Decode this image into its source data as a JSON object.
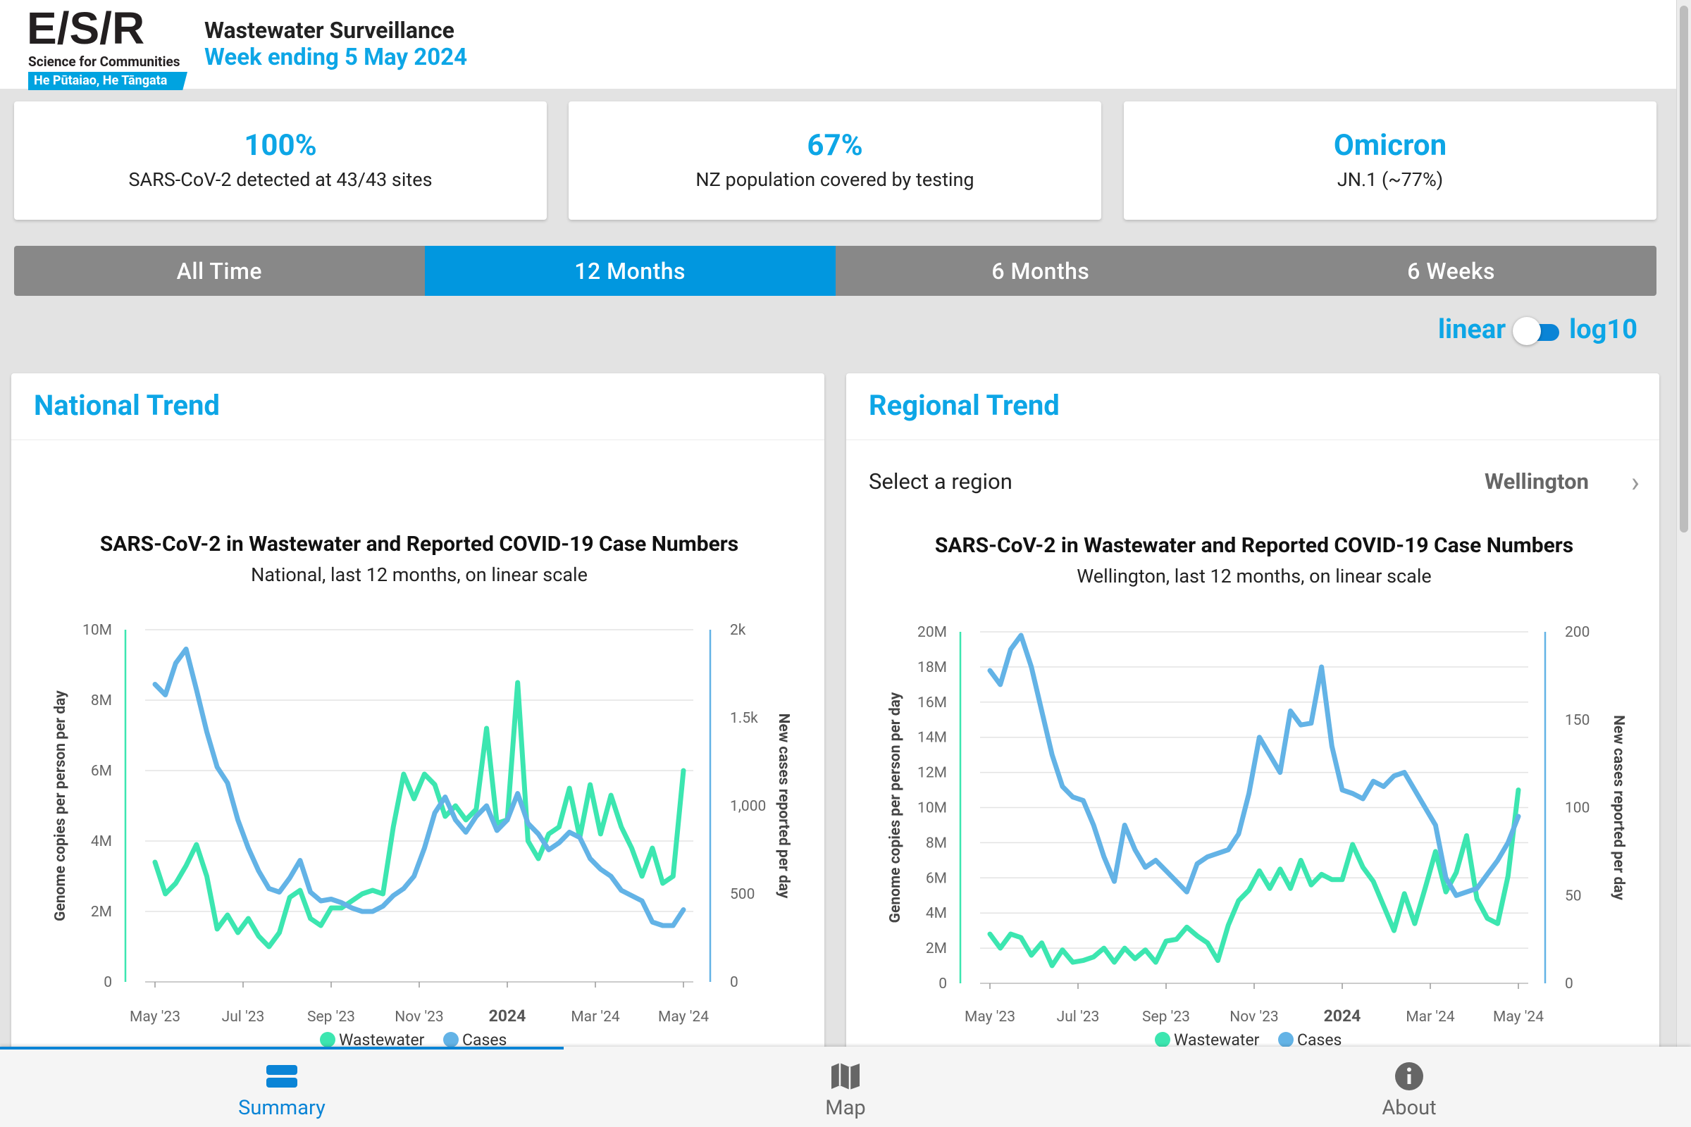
{
  "brand": {
    "logo_text": "E/S/R",
    "tagline": "Science for Communities",
    "tagline_maori": "He Pūtaiao, He Tāngata"
  },
  "header": {
    "title": "Wastewater Surveillance",
    "week": "Week ending 5 May 2024"
  },
  "kpis": [
    {
      "value": "100%",
      "label": "SARS-CoV-2 detected at 43/43 sites"
    },
    {
      "value": "67%",
      "label": "NZ population covered by testing"
    },
    {
      "value": "Omicron",
      "label": "JN.1 (~77%)"
    }
  ],
  "range_tabs": [
    {
      "label": "All Time",
      "active": false
    },
    {
      "label": "12 Months",
      "active": true
    },
    {
      "label": "6 Months",
      "active": false
    },
    {
      "label": "6 Weeks",
      "active": false
    }
  ],
  "scale_toggle": {
    "left": "linear",
    "right": "log10",
    "selected": "linear"
  },
  "national": {
    "card_title": "National Trend"
  },
  "regional": {
    "card_title": "Regional Trend",
    "select_label": "Select a region",
    "selected_region": "Wellington"
  },
  "bottom_nav": [
    {
      "label": "Summary",
      "icon": "summary-icon",
      "active": true
    },
    {
      "label": "Map",
      "icon": "map-icon",
      "active": false
    },
    {
      "label": "About",
      "icon": "info-icon",
      "active": false
    }
  ],
  "colors": {
    "wastewater": "#3ce6b0",
    "cases": "#63b3e6",
    "accent": "#0da6e6",
    "tab_active": "#0197df"
  },
  "chart_data": [
    {
      "type": "line",
      "title": "SARS-CoV-2 in Wastewater and Reported COVID-19 Case Numbers",
      "subtitle": "National, last 12 months, on linear scale",
      "ylabel": "Genome copies per person per day",
      "y2label": "New cases reported per day",
      "xticks": [
        "May '23",
        "Jul '23",
        "Sep '23",
        "Nov '23",
        "2024",
        "Mar '24",
        "May '24"
      ],
      "yticks": [
        "0",
        "2M",
        "4M",
        "6M",
        "8M",
        "10M"
      ],
      "y2ticks": [
        "0",
        "500",
        "1,000",
        "1.5k",
        "2k"
      ],
      "ylim": [
        0,
        10000000
      ],
      "y2lim": [
        0,
        2000
      ],
      "x_weeks": 52,
      "series": [
        {
          "name": "Wastewater",
          "axis": "left",
          "color": "#3ce6b0",
          "values": [
            3.4,
            2.5,
            2.8,
            3.3,
            3.9,
            3.0,
            1.5,
            1.9,
            1.4,
            1.8,
            1.3,
            1.0,
            1.4,
            2.4,
            2.6,
            1.8,
            1.6,
            2.1,
            2.1,
            2.3,
            2.5,
            2.6,
            2.5,
            4.4,
            5.9,
            5.2,
            5.9,
            5.6,
            4.7,
            5.0,
            4.6,
            4.9,
            7.2,
            4.5,
            4.6,
            8.5,
            4.0,
            3.5,
            4.2,
            4.4,
            5.5,
            4.1,
            5.6,
            4.2,
            5.3,
            4.4,
            3.8,
            3.0,
            3.8,
            2.8,
            3.0,
            6.0
          ]
        },
        {
          "name": "Cases",
          "axis": "right",
          "color": "#63b3e6",
          "values": [
            1690,
            1630,
            1810,
            1890,
            1660,
            1420,
            1220,
            1130,
            920,
            760,
            630,
            530,
            510,
            590,
            690,
            510,
            460,
            470,
            450,
            420,
            400,
            400,
            430,
            490,
            530,
            600,
            760,
            960,
            1050,
            920,
            850,
            940,
            1000,
            860,
            920,
            1070,
            900,
            840,
            750,
            790,
            850,
            820,
            700,
            640,
            600,
            520,
            490,
            460,
            340,
            320,
            320,
            410
          ]
        }
      ]
    },
    {
      "type": "line",
      "title": "SARS-CoV-2 in Wastewater and Reported COVID-19 Case Numbers",
      "subtitle": "Wellington, last 12 months, on linear scale",
      "ylabel": "Genome copies per person per day",
      "y2label": "New cases reported per day",
      "xticks": [
        "May '23",
        "Jul '23",
        "Sep '23",
        "Nov '23",
        "2024",
        "Mar '24",
        "May '24"
      ],
      "yticks": [
        "0",
        "2M",
        "4M",
        "6M",
        "8M",
        "10M",
        "12M",
        "14M",
        "16M",
        "18M",
        "20M"
      ],
      "y2ticks": [
        "0",
        "50",
        "100",
        "150",
        "200"
      ],
      "ylim": [
        0,
        20000000
      ],
      "y2lim": [
        0,
        200
      ],
      "x_weeks": 52,
      "series": [
        {
          "name": "Wastewater",
          "axis": "left",
          "color": "#3ce6b0",
          "values": [
            2.8,
            2.0,
            2.8,
            2.6,
            1.6,
            2.3,
            1.0,
            1.9,
            1.2,
            1.3,
            1.5,
            2.0,
            1.2,
            2.0,
            1.4,
            1.9,
            1.2,
            2.4,
            2.5,
            3.2,
            2.7,
            2.3,
            1.3,
            3.3,
            4.7,
            5.3,
            6.4,
            5.4,
            6.5,
            5.4,
            7.0,
            5.6,
            6.2,
            5.9,
            5.9,
            7.9,
            6.6,
            5.8,
            4.4,
            3.0,
            5.1,
            3.4,
            5.4,
            7.5,
            5.2,
            6.3,
            8.4,
            4.8,
            3.7,
            3.4,
            6.1,
            11.0
          ]
        },
        {
          "name": "Cases",
          "axis": "right",
          "color": "#63b3e6",
          "values": [
            178,
            170,
            190,
            198,
            180,
            155,
            130,
            112,
            106,
            104,
            90,
            72,
            58,
            90,
            76,
            66,
            70,
            64,
            58,
            52,
            68,
            72,
            74,
            76,
            85,
            108,
            140,
            130,
            120,
            155,
            147,
            148,
            180,
            135,
            110,
            108,
            105,
            115,
            112,
            118,
            120,
            110,
            100,
            90,
            60,
            50,
            52,
            54,
            62,
            70,
            80,
            95
          ]
        }
      ]
    }
  ]
}
